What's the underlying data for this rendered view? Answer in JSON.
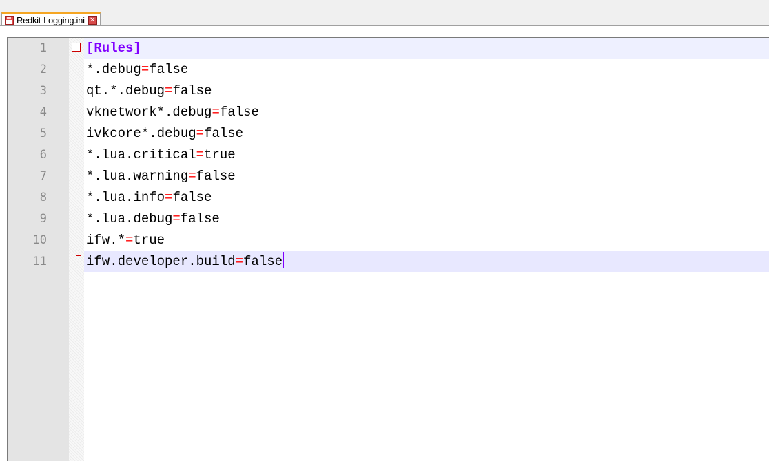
{
  "tab": {
    "title": "Redkit-Logging.ini",
    "icon": "save-disk-icon",
    "close_icon": "close-icon"
  },
  "colors": {
    "section": "#8000ff",
    "operator": "#ff0000",
    "line_number": "#8a8a8a",
    "current_line": "#e8e8ff",
    "fold_marker": "#cc0000",
    "tab_accent": "#f5a623"
  },
  "editor": {
    "lines": [
      {
        "n": "1",
        "section": "[Rules]"
      },
      {
        "n": "2",
        "key": "*.debug",
        "eq": "=",
        "value": "false"
      },
      {
        "n": "3",
        "key": "qt.*.debug",
        "eq": "=",
        "value": "false"
      },
      {
        "n": "4",
        "key": "vknetwork*.debug",
        "eq": "=",
        "value": "false"
      },
      {
        "n": "5",
        "key": "ivkcore*.debug",
        "eq": "=",
        "value": "false"
      },
      {
        "n": "6",
        "key": "*.lua.critical",
        "eq": "=",
        "value": "true"
      },
      {
        "n": "7",
        "key": "*.lua.warning",
        "eq": "=",
        "value": "false"
      },
      {
        "n": "8",
        "key": "*.lua.info",
        "eq": "=",
        "value": "false"
      },
      {
        "n": "9",
        "key": "*.lua.debug",
        "eq": "=",
        "value": "false"
      },
      {
        "n": "10",
        "key": "ifw.*",
        "eq": "=",
        "value": "true"
      },
      {
        "n": "11",
        "key": "ifw.developer.build",
        "eq": "=",
        "value": "false"
      }
    ]
  }
}
